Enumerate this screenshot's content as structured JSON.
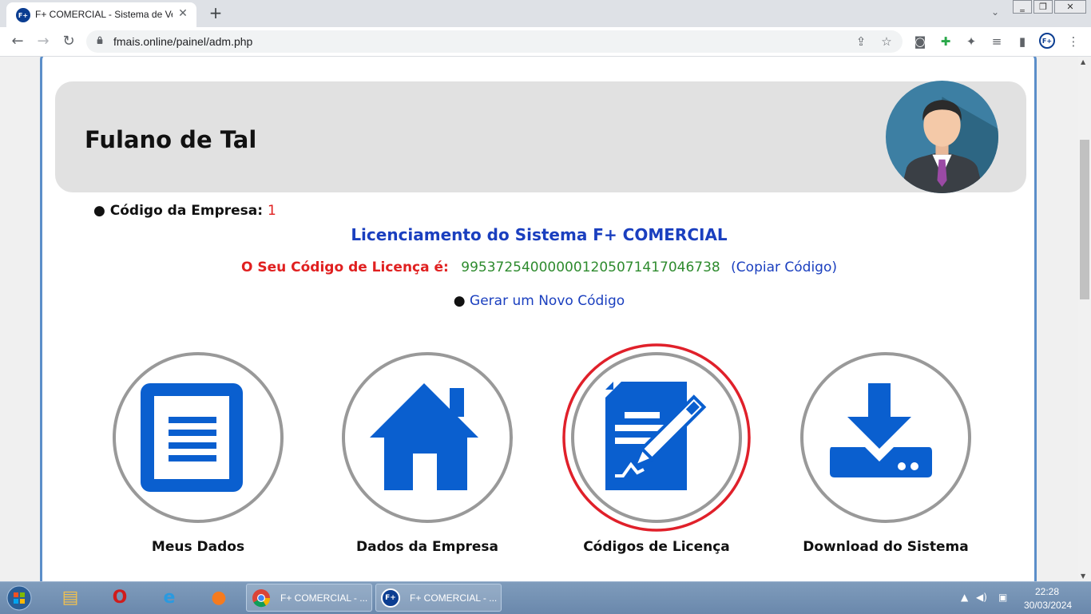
{
  "browser": {
    "tab_title": "F+ COMERCIAL - Sistema de Vendas",
    "favicon_text": "F+",
    "tab_close": "✕",
    "new_tab": "+",
    "dropdown": "⌄",
    "window_buttons": [
      "‗",
      "❐",
      "✕"
    ],
    "back": "←",
    "forward": "→",
    "reload": "↻",
    "url": "fmais.online/painel/adm.php",
    "profile_text": "F+"
  },
  "header": {
    "user_name": "Fulano de Tal"
  },
  "company": {
    "bullet": "●",
    "label": "Código da Empresa:",
    "code": "1"
  },
  "license": {
    "title": "Licenciamento do Sistema F+ COMERCIAL",
    "label": "O Seu Código de Licença é:",
    "code": "99537254000000120507141704673​8",
    "open_paren": "(",
    "copy_label": "Copiar Código",
    "close_paren": ")",
    "generate_bullet": "●",
    "generate_label": "Gerar um Novo Código"
  },
  "tiles": [
    {
      "label": "Meus Dados",
      "icon": "document-icon"
    },
    {
      "label": "Dados da Empresa",
      "icon": "house-icon"
    },
    {
      "label": "Códigos de Licença",
      "icon": "license-sign-icon",
      "highlighted": true
    },
    {
      "label": "Download do Sistema",
      "icon": "download-icon"
    }
  ],
  "taskbar": {
    "tasks": [
      {
        "label": "F+ COMERCIAL - ...",
        "icon": "chrome-icon"
      },
      {
        "label": "F+ COMERCIAL - ...",
        "icon": "fplus-app-icon"
      }
    ],
    "time": "22:28",
    "date": "30/03/2024"
  },
  "colors": {
    "accent_blue": "#0a5fcf",
    "license_red": "#e02020",
    "license_code_green": "#2e8b2e",
    "link_blue": "#1a3fbf",
    "highlight_ring": "#e0202a"
  }
}
